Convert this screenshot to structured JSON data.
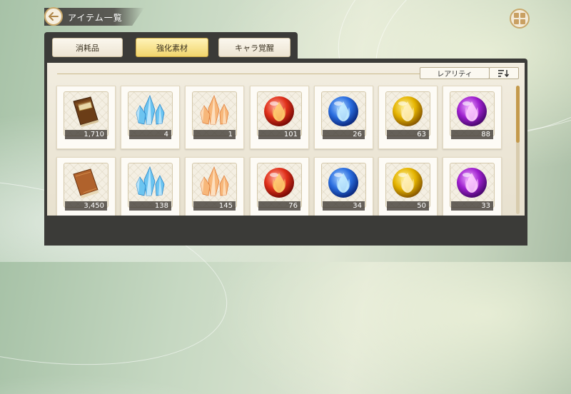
{
  "header": {
    "title": "アイテム一覧"
  },
  "tabs": [
    {
      "label": "消耗品",
      "active": false
    },
    {
      "label": "強化素材",
      "active": true
    },
    {
      "label": "キャラ覚醒",
      "active": false
    }
  ],
  "sort": {
    "label": "レアリティ"
  },
  "items": [
    {
      "icon": "brown-book-icon",
      "count": "1,710"
    },
    {
      "icon": "blue-crystal-icon",
      "count": "4"
    },
    {
      "icon": "orange-crystal-icon",
      "count": "1"
    },
    {
      "icon": "red-orb-icon",
      "count": "101"
    },
    {
      "icon": "blue-orb-icon",
      "count": "26"
    },
    {
      "icon": "yellow-orb-icon",
      "count": "63"
    },
    {
      "icon": "purple-orb-icon",
      "count": "88"
    },
    {
      "icon": "orange-book-icon",
      "count": "3,450"
    },
    {
      "icon": "blue-crystal-icon",
      "count": "138"
    },
    {
      "icon": "orange-crystal-icon",
      "count": "145"
    },
    {
      "icon": "red-orb-icon",
      "count": "76"
    },
    {
      "icon": "blue-orb-icon",
      "count": "34"
    },
    {
      "icon": "yellow-orb-icon",
      "count": "50"
    },
    {
      "icon": "purple-orb-icon",
      "count": "33"
    }
  ]
}
